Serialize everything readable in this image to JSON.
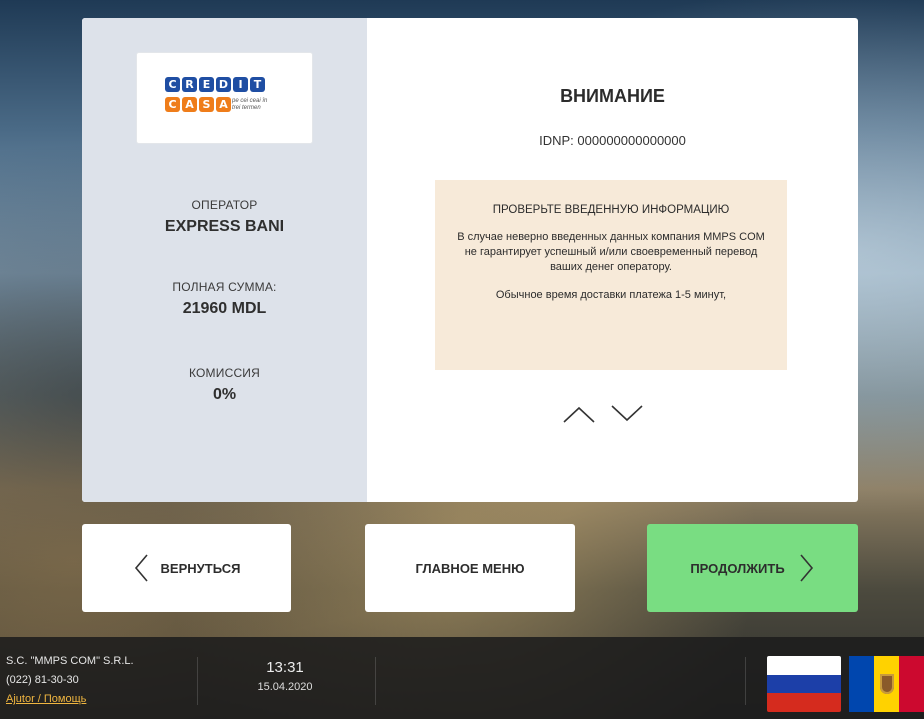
{
  "provider": {
    "logo": {
      "row1_letters": [
        "C",
        "R",
        "E",
        "D",
        "I",
        "T"
      ],
      "row2_letters": [
        "C",
        "A",
        "S",
        "A"
      ],
      "tagline": "pe cei ceai în trei termen",
      "colors": {
        "blue": "#1f4ea3",
        "orange": "#ef7d1a"
      }
    },
    "operator_label": "ОПЕРАТОР",
    "operator_value": "EXPRESS BANI",
    "total_label": "ПОЛНАЯ СУММА:",
    "total_value": "21960 MDL",
    "commission_label": "КОМИССИЯ",
    "commission_value": "0%"
  },
  "warning": {
    "title": "ВНИМАНИЕ",
    "idnp": "IDNP: 000000000000000",
    "notice_heading": "ПРОВЕРЬТЕ ВВЕДЕННУЮ ИНФОРМАЦИЮ",
    "notice_text": "В случае неверно введенных данных компания MMPS COM не гарантирует успешный и/или своевременный перевод ваших денег оператору.",
    "notice_text2": "Обычное время доставки платежа 1-5 минут,",
    "scroll_up_icon": "chevron-up-icon",
    "scroll_down_icon": "chevron-down-icon"
  },
  "buttons": {
    "back_label": "ВЕРНУТЬСЯ",
    "menu_label": "ГЛАВНОЕ МЕНЮ",
    "next_label": "ПРОДОЛЖИТЬ",
    "next_color": "#79dd82"
  },
  "footer": {
    "company": "S.C. \"MMPS COM\" S.R.L.",
    "phone": "(022) 81-30-30",
    "help_link": "Ajutor / Помощь",
    "time": "13:31",
    "date": "15.04.2020",
    "languages": [
      "russian-flag-icon",
      "moldova-flag-icon"
    ]
  }
}
